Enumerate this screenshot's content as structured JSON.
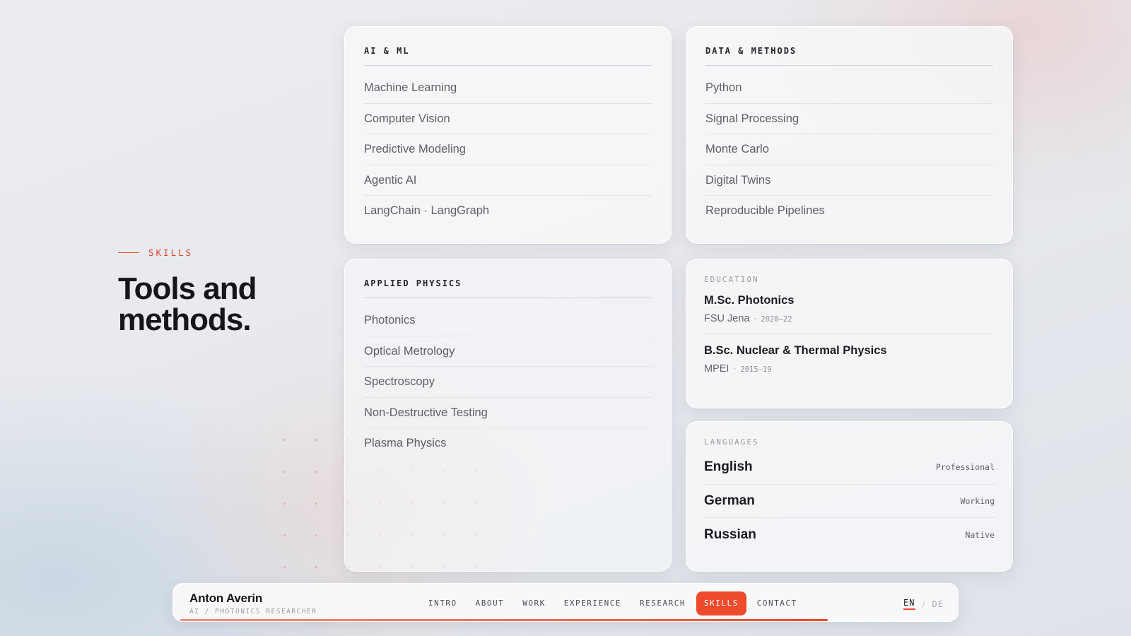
{
  "section": {
    "eyebrow": "SKILLS",
    "headline_line1": "Tools and",
    "headline_line2": "methods."
  },
  "cards": {
    "ai_ml": {
      "title": "AI & ML",
      "items": [
        "Machine Learning",
        "Computer Vision",
        "Predictive Modeling",
        "Agentic AI",
        "LangChain · LangGraph"
      ]
    },
    "data_methods": {
      "title": "DATA & METHODS",
      "items": [
        "Python",
        "Signal Processing",
        "Monte Carlo",
        "Digital Twins",
        "Reproducible Pipelines"
      ]
    },
    "applied_physics": {
      "title": "APPLIED PHYSICS",
      "items": [
        "Photonics",
        "Optical Metrology",
        "Spectroscopy",
        "Non-Destructive Testing",
        "Plasma Physics"
      ]
    }
  },
  "education": {
    "label": "EDUCATION",
    "entries": [
      {
        "degree": "M.Sc. Photonics",
        "school": "FSU Jena",
        "years": "2020–22"
      },
      {
        "degree": "B.Sc. Nuclear & Thermal Physics",
        "school": "MPEI",
        "years": "2015–19"
      }
    ]
  },
  "languages": {
    "label": "LANGUAGES",
    "entries": [
      {
        "name": "English",
        "level": "Professional"
      },
      {
        "name": "German",
        "level": "Working"
      },
      {
        "name": "Russian",
        "level": "Native"
      }
    ]
  },
  "nav": {
    "brand_name": "Anton Averin",
    "brand_sub": "AI / PHOTONICS RESEARCHER",
    "links": [
      "INTRO",
      "ABOUT",
      "WORK",
      "EXPERIENCE",
      "RESEARCH",
      "SKILLS",
      "CONTACT"
    ],
    "active": "SKILLS",
    "lang_en": "EN",
    "lang_sep": "/",
    "lang_de": "DE",
    "scroll_progress": 0.84
  },
  "colors": {
    "accent": "#ee4a2c",
    "heading": "#15161a",
    "muted": "#9a9ca3"
  }
}
